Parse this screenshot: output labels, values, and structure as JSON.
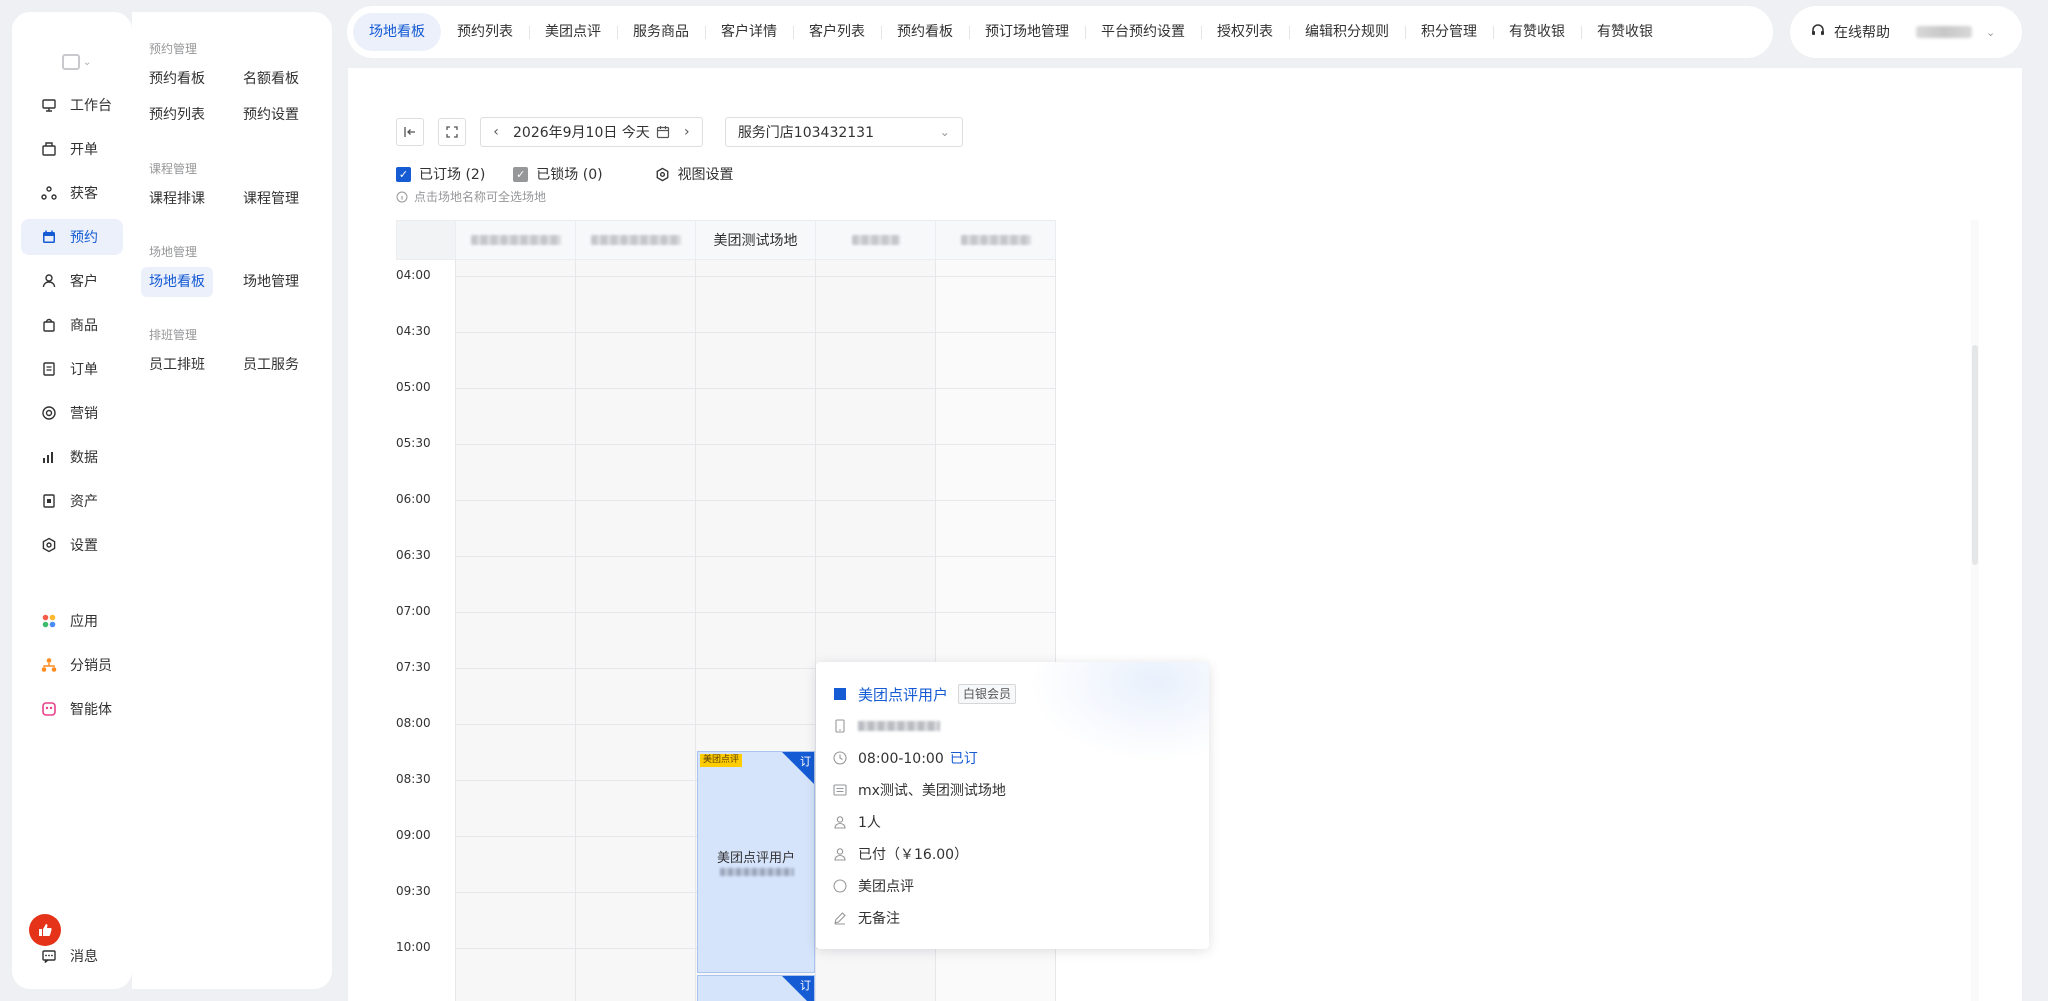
{
  "nav": {
    "items": [
      {
        "label": "工作台",
        "icon": "workbench-icon"
      },
      {
        "label": "开单",
        "icon": "cashier-icon"
      },
      {
        "label": "获客",
        "icon": "acquire-icon"
      },
      {
        "label": "预约",
        "icon": "calendar-icon"
      },
      {
        "label": "客户",
        "icon": "user-icon"
      },
      {
        "label": "商品",
        "icon": "bag-icon"
      },
      {
        "label": "订单",
        "icon": "order-icon"
      },
      {
        "label": "营销",
        "icon": "target-icon"
      },
      {
        "label": "数据",
        "icon": "chart-icon"
      },
      {
        "label": "资产",
        "icon": "asset-icon"
      },
      {
        "label": "设置",
        "icon": "gear-icon"
      },
      {
        "label": "应用",
        "icon": "apps-icon"
      },
      {
        "label": "分销员",
        "icon": "distributor-icon"
      },
      {
        "label": "智能体",
        "icon": "agent-icon"
      }
    ],
    "message": "消息"
  },
  "subnav": {
    "groups": [
      {
        "title": "预约管理",
        "links": [
          "预约看板",
          "名额看板",
          "预约列表",
          "预约设置"
        ]
      },
      {
        "title": "课程管理",
        "links": [
          "课程排课",
          "课程管理"
        ]
      },
      {
        "title": "场地管理",
        "links": [
          "场地看板",
          "场地管理"
        ]
      },
      {
        "title": "排班管理",
        "links": [
          "员工排班",
          "员工服务"
        ]
      }
    ]
  },
  "tabs": [
    "场地看板",
    "预约列表",
    "美团点评",
    "服务商品",
    "客户详情",
    "客户列表",
    "预约看板",
    "预订场地管理",
    "平台预约设置",
    "授权列表",
    "编辑积分规则",
    "积分管理",
    "有赞收银",
    "有赞收银"
  ],
  "help": "在线帮助",
  "toolbar": {
    "date": "2026年9月10日 今天",
    "store": "服务门店103432131"
  },
  "filters": {
    "booked": "已订场 (2)",
    "locked": "已锁场 (0)",
    "view_settings": "视图设置",
    "hint": "点击场地名称可全选场地"
  },
  "venues": [
    "",
    "",
    "美团测试场地",
    "",
    ""
  ],
  "times": [
    "04:00",
    "04:30",
    "05:00",
    "05:30",
    "06:00",
    "06:30",
    "07:00",
    "07:30",
    "08:00",
    "08:30",
    "09:00",
    "09:30",
    "10:00"
  ],
  "booking": {
    "source_tag": "美团点评",
    "badge": "订",
    "name": "美团点评用户"
  },
  "popover": {
    "name": "美团点评用户",
    "member": "白银会员",
    "time": "08:00-10:00",
    "status": "已订",
    "venue": "mx测试、美团测试场地",
    "people": "1人",
    "payment": "已付（￥16.00）",
    "channel": "美团点评",
    "remark": "无备注"
  },
  "colors": {
    "accent": "#155bd4",
    "active_bg": "#ebf0fa",
    "booking_bg": "#d6e4fb"
  }
}
